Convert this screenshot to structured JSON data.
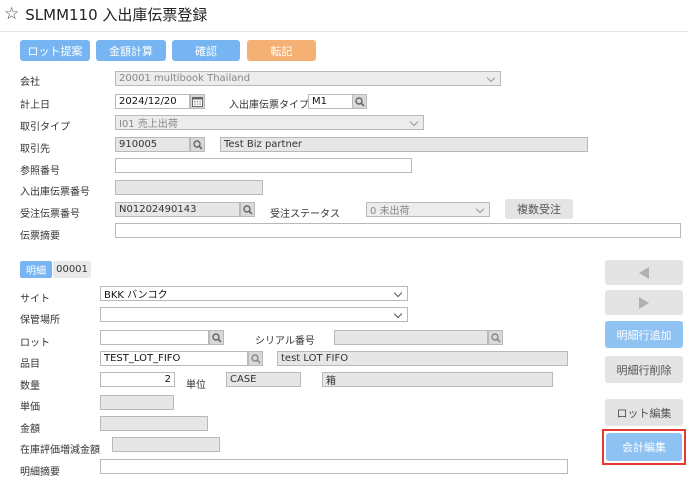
{
  "header": {
    "title": "SLMM110 入出庫伝票登録"
  },
  "toolbar": {
    "lot_propose": "ロット提案",
    "amount_calc": "金額計算",
    "confirm": "確認",
    "transfer": "転記"
  },
  "form": {
    "company": {
      "label": "会社",
      "value": "20001 multibook Thailand"
    },
    "posting_date": {
      "label": "計上日",
      "value": "2024/12/20"
    },
    "slip_type": {
      "label": "入出庫伝票タイプ",
      "value": "M1"
    },
    "transaction_type": {
      "label": "取引タイプ",
      "value": "I01 売上出荷"
    },
    "partner": {
      "label": "取引先",
      "code": "910005",
      "name": "Test Biz partner"
    },
    "reference_no": {
      "label": "参照番号",
      "value": ""
    },
    "slip_no": {
      "label": "入出庫伝票番号",
      "value": ""
    },
    "order_no": {
      "label": "受注伝票番号",
      "value": "N01202490143"
    },
    "order_status": {
      "label": "受注ステータス",
      "value": "0 未出荷"
    },
    "multi_order_button": "複数受注",
    "memo": {
      "label": "伝票摘要",
      "value": ""
    }
  },
  "detail": {
    "tab_label": "明細",
    "line_no": "00001",
    "site": {
      "label": "サイト",
      "value": "BKK バンコク"
    },
    "location": {
      "label": "保管場所",
      "value": ""
    },
    "lot": {
      "label": "ロット",
      "value": ""
    },
    "serial": {
      "label": "シリアル番号",
      "value": ""
    },
    "item": {
      "label": "品目",
      "code": "TEST_LOT_FIFO",
      "name": "test LOT FIFO"
    },
    "quantity": {
      "label": "数量",
      "value": "2"
    },
    "unit": {
      "label": "単位",
      "code": "CASE",
      "name": "箱"
    },
    "unit_price": {
      "label": "単価",
      "value": ""
    },
    "amount": {
      "label": "金額",
      "value": ""
    },
    "inventory_change": {
      "label": "在庫評価増減金額",
      "value": ""
    },
    "line_memo": {
      "label": "明細摘要",
      "value": ""
    }
  },
  "side": {
    "add_line": "明細行追加",
    "delete_line": "明細行削除",
    "lot_edit": "ロット編集",
    "account_edit": "会計編集"
  },
  "colors": {
    "primary_button": "#76b5f1",
    "transfer_button": "#f4b173",
    "highlight_border": "#e53935"
  }
}
